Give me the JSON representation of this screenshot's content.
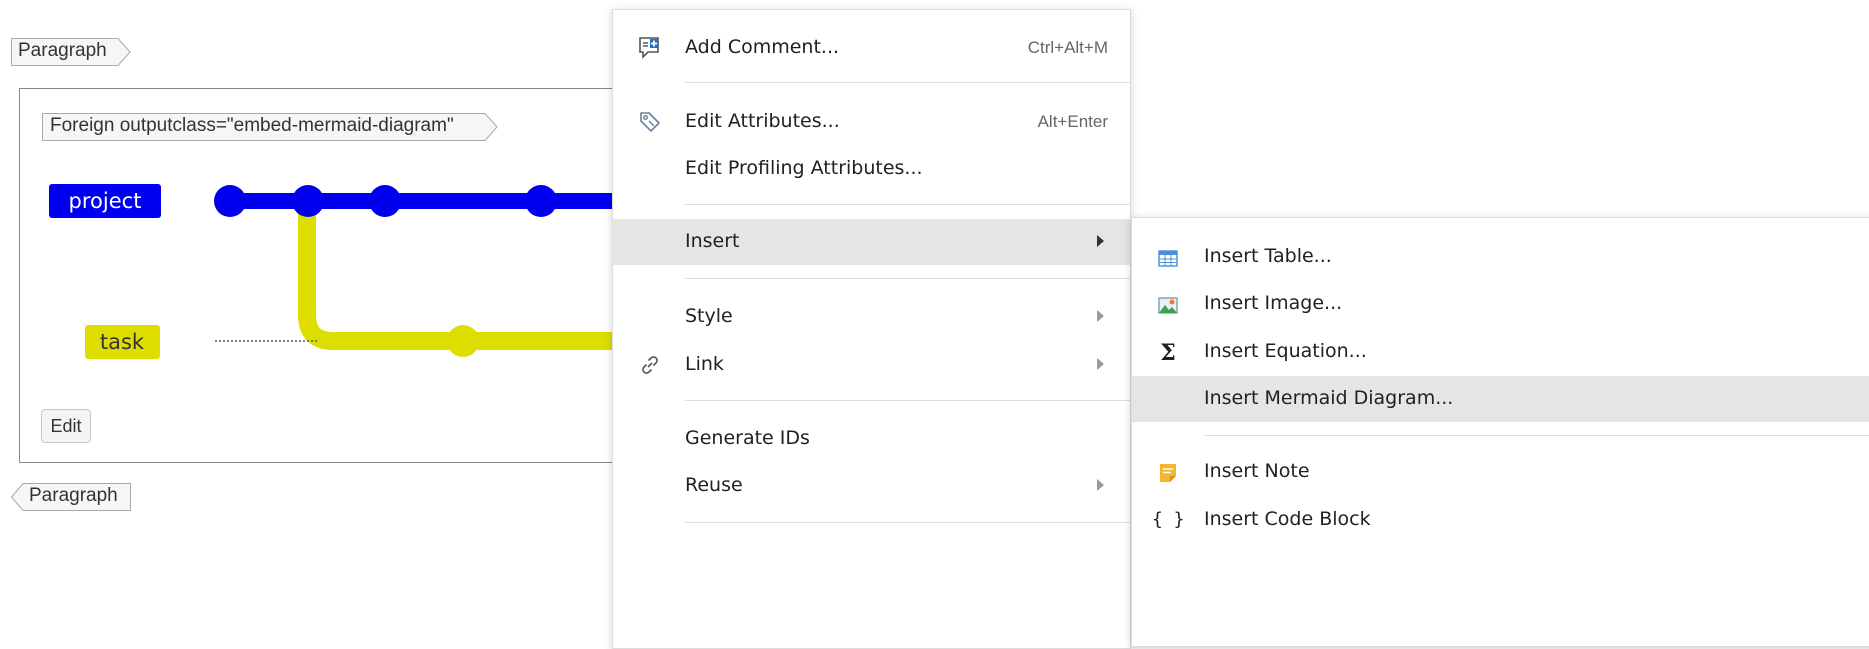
{
  "editor": {
    "paragraph_start_tag": "Paragraph",
    "foreign_tag": "Foreign outputclass=\"embed-mermaid-diagram\"",
    "paragraph_end_tag": "Paragraph",
    "edit_button": "Edit"
  },
  "diagram": {
    "branches": [
      {
        "name": "project",
        "color": "#0000ee",
        "label_text_color": "#ffffff"
      },
      {
        "name": "task",
        "color": "#dddd00",
        "label_text_color": "#333333"
      }
    ]
  },
  "context_menu": {
    "items": [
      {
        "label": "Add Comment...",
        "shortcut": "Ctrl+Alt+M",
        "icon": "add-comment-icon"
      },
      {
        "label": "Edit Attributes...",
        "shortcut": "Alt+Enter",
        "icon": "tag-icon"
      },
      {
        "label": "Edit Profiling Attributes..."
      },
      {
        "label": "Insert",
        "submenu": true,
        "highlighted": true
      },
      {
        "label": "Style",
        "submenu": true
      },
      {
        "label": "Link",
        "submenu": true,
        "icon": "link-icon"
      },
      {
        "label": "Generate IDs"
      },
      {
        "label": "Reuse",
        "submenu": true
      }
    ]
  },
  "insert_submenu": {
    "items": [
      {
        "label": "Insert Table...",
        "icon": "table-icon"
      },
      {
        "label": "Insert Image...",
        "icon": "image-icon"
      },
      {
        "label": "Insert Equation...",
        "icon": "sigma-icon"
      },
      {
        "label": "Insert Mermaid Diagram...",
        "highlighted": true
      },
      {
        "label": "Insert Note",
        "icon": "note-icon"
      },
      {
        "label": "Insert Code Block",
        "icon": "code-braces-icon",
        "icon_text": "{ }"
      }
    ]
  },
  "colors": {
    "highlight": "#e5e5e5",
    "table_icon": "#4a8fd6",
    "note_icon": "#f5b431"
  }
}
